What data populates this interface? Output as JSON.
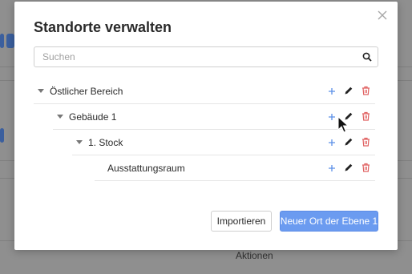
{
  "modal": {
    "title": "Standorte verwalten",
    "search": {
      "placeholder": "Suchen",
      "value": ""
    },
    "tree": [
      {
        "label": "Östlicher Bereich",
        "expanded": true
      },
      {
        "label": "Gebäude 1",
        "expanded": true
      },
      {
        "label": "1. Stock",
        "expanded": true
      },
      {
        "label": "Ausstattungsraum",
        "expanded": false
      }
    ],
    "buttons": {
      "import": "Importieren",
      "new_location": "Neuer Ort der Ebene 1"
    }
  },
  "background": {
    "footer_label": "Aktionen"
  },
  "colors": {
    "add": "#5b8fe8",
    "edit": "#222222",
    "delete": "#e06060",
    "primary": "#6b9bf0"
  },
  "icons": {
    "add": "plus-icon",
    "edit": "pencil-icon",
    "delete": "trash-icon",
    "close": "close-icon",
    "search": "search-icon",
    "caret": "caret-down-icon"
  }
}
